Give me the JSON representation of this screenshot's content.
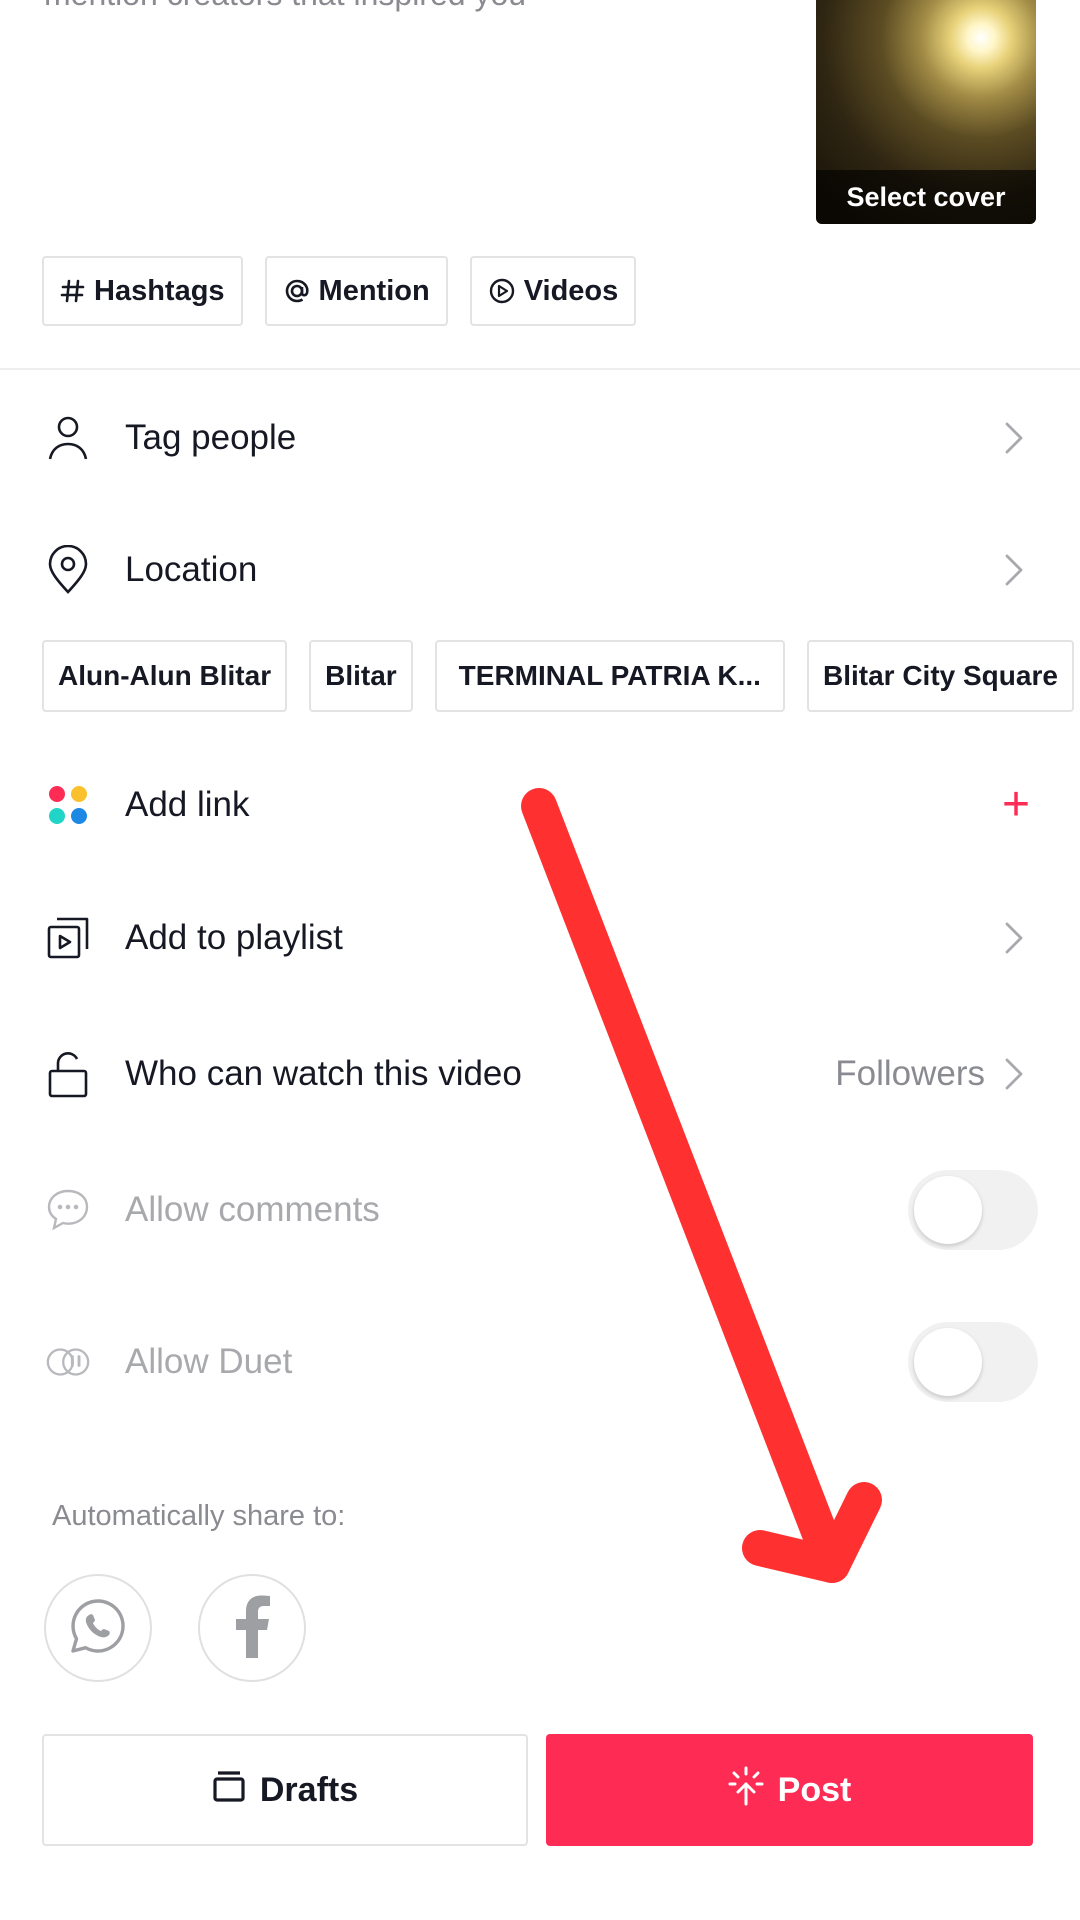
{
  "caption": {
    "placeholder_partial": "mention creators that inspired you"
  },
  "cover": {
    "label": "Select cover"
  },
  "caption_chips": [
    {
      "icon": "hash-icon",
      "label": "Hashtags"
    },
    {
      "icon": "at-icon",
      "label": "Mention"
    },
    {
      "icon": "play-circle-icon",
      "label": "Videos"
    }
  ],
  "settings": {
    "tag_people": {
      "icon": "person-icon",
      "label": "Tag people"
    },
    "location": {
      "icon": "location-pin-icon",
      "label": "Location"
    },
    "location_suggestions": [
      "Alun-Alun Blitar",
      "Blitar",
      "TERMINAL PATRIA K...",
      "Blitar City Square"
    ],
    "add_link": {
      "icon": "four-dots-icon",
      "label": "Add link",
      "action": "+"
    },
    "add_to_playlist": {
      "icon": "playlist-icon",
      "label": "Add to playlist"
    },
    "who_can_watch": {
      "icon": "lock-icon",
      "label": "Who can watch this video",
      "value": "Followers"
    },
    "allow_comments": {
      "icon": "comment-icon",
      "label": "Allow comments",
      "enabled": false
    },
    "allow_duet": {
      "icon": "duet-icon",
      "label": "Allow Duet",
      "enabled": false
    }
  },
  "share": {
    "label": "Automatically share to:",
    "targets": [
      "whatsapp-icon",
      "facebook-icon"
    ]
  },
  "actions": {
    "drafts_label": "Drafts",
    "post_label": "Post"
  },
  "colors": {
    "accent": "#fe2c55",
    "annotation_arrow": "#ff3030",
    "text": "#161823",
    "muted": "#8a8b91"
  }
}
